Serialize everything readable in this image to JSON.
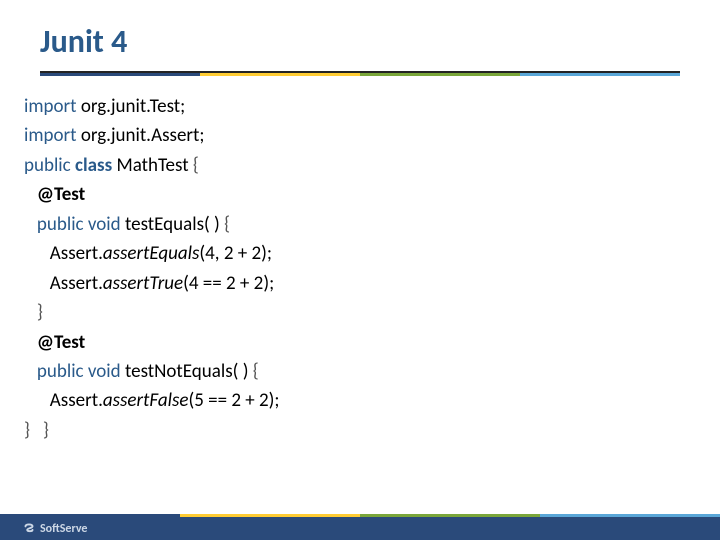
{
  "slide": {
    "title": "Junit 4",
    "code": {
      "l1_kw": "import",
      "l1_pkg": " org.junit.Test;",
      "l2_kw": "import",
      "l2_pkg": " org.junit.Assert;",
      "l3_kw1": "public",
      "l3_kw2": " class",
      "l3_name": " MathTest",
      "l3_brace": " {",
      "l4_anno": "   @Test",
      "l5_kw": "   public void",
      "l5_name": " testEquals( )",
      "l5_brace": " {",
      "l6_obj": "      Assert.",
      "l6_method": "assertEquals",
      "l6_args": "(4, 2 + 2);",
      "l7_obj": "      Assert.",
      "l7_method": "assertTrue",
      "l7_args": "(4 == 2 + 2);",
      "l8": "   }",
      "l9_anno": "   @Test",
      "l10_kw": "   public void",
      "l10_name": " testNotEquals( )",
      "l10_brace": " {",
      "l11_obj": "      Assert.",
      "l11_method": "assertFalse",
      "l11_args": "(5 == 2 + 2);",
      "l12": "}   }"
    },
    "footer_brand": "SoftServe"
  }
}
